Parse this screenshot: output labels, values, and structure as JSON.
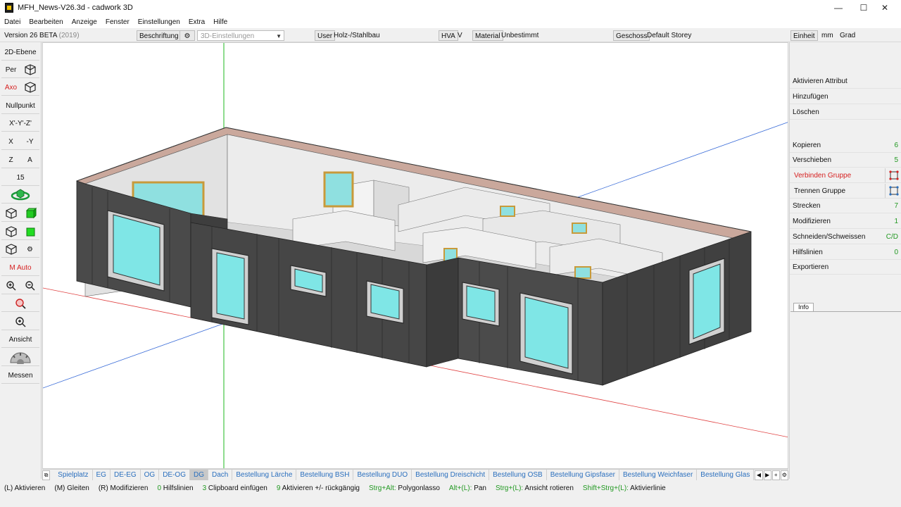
{
  "window": {
    "title": "MFH_News-V26.3d - cadwork 3D",
    "minimize": "—",
    "maximize": "☐",
    "close": "✕"
  },
  "menu": [
    "Datei",
    "Bearbeiten",
    "Anzeige",
    "Fenster",
    "Einstellungen",
    "Extra",
    "Hilfe"
  ],
  "optbar": {
    "version": "Version 26 BETA",
    "version_year": "(2019)",
    "beschriftung": "Beschriftung",
    "settings_dropdown": "3D-Einstellungen",
    "user_btn": "User",
    "user_value": "Holz-/Stahlbau",
    "hva_btn": "HVA",
    "hva_value": "V",
    "material_btn": "Material",
    "material_value": "Unbestimmt",
    "geschoss_btn": "Geschoss",
    "geschoss_value": "Default Storey",
    "einheit_btn": "Einheit",
    "unit_mm": "mm",
    "unit_grad": "Grad"
  },
  "left": {
    "ebene": "2D-Ebene",
    "per": "Per",
    "axo": "Axo",
    "nullpunkt": "Nullpunkt",
    "xyz": "X'-Y'-Z'",
    "x": "X",
    "neg_y": "-Y",
    "z": "Z",
    "a": "A",
    "fifteen": "15",
    "m_auto": "M Auto",
    "ansicht": "Ansicht",
    "messen": "Messen"
  },
  "right": {
    "aktivieren_attribut": "Aktivieren Attribut",
    "hinzufuegen": "Hinzufügen",
    "loeschen": "Löschen",
    "kopieren": "Kopieren",
    "kopieren_count": "6",
    "verschieben": "Verschieben",
    "verschieben_count": "5",
    "verbinden": "Verbinden Gruppe",
    "trennen": "Trennen Gruppe",
    "strecken": "Strecken",
    "strecken_count": "7",
    "modifizieren": "Modifizieren",
    "modifizieren_count": "1",
    "schneiden": "Schneiden/Schweissen",
    "schneiden_count": "C/D",
    "hilfslinien": "Hilfslinien",
    "hilfslinien_count": "0",
    "exportieren": "Exportieren",
    "info": "Info"
  },
  "tabs": [
    "Spielplatz",
    "EG",
    "DE-EG",
    "OG",
    "DE-OG",
    "DG",
    "Dach",
    "Bestellung Lärche",
    "Bestellung BSH",
    "Bestellung DUO",
    "Bestellung Dreischicht",
    "Bestellung OSB",
    "Bestellung Gipsfaser",
    "Bestellung Weichfaser",
    "Bestellung Glas"
  ],
  "active_tab": "DG",
  "status": [
    {
      "key": "(L)",
      "text": " Aktivieren"
    },
    {
      "key": "(M)",
      "text": " Gleiten"
    },
    {
      "key": "(R)",
      "text": " Modifizieren"
    },
    {
      "key": "0",
      "text": " Hilfslinien"
    },
    {
      "key": "3",
      "text": " Clipboard einfügen"
    },
    {
      "key": "9",
      "text": " Aktivieren +/- rückgängig"
    },
    {
      "key": "Strg+Alt:",
      "text": " Polygonlasso"
    },
    {
      "key": "Alt+(L):",
      "text": " Pan"
    },
    {
      "key": "Strg+(L):",
      "text": " Ansicht rotieren"
    },
    {
      "key": "Shift+Strg+(L):",
      "text": " Aktivierlinie"
    }
  ],
  "colors": {
    "accent_blue": "#2a6fbe",
    "status_green": "#229922",
    "highlight_red": "#d62020",
    "wall_dark": "#4a4a4a",
    "glass": "#7fe6e6",
    "frame_wood": "#d9a640"
  }
}
